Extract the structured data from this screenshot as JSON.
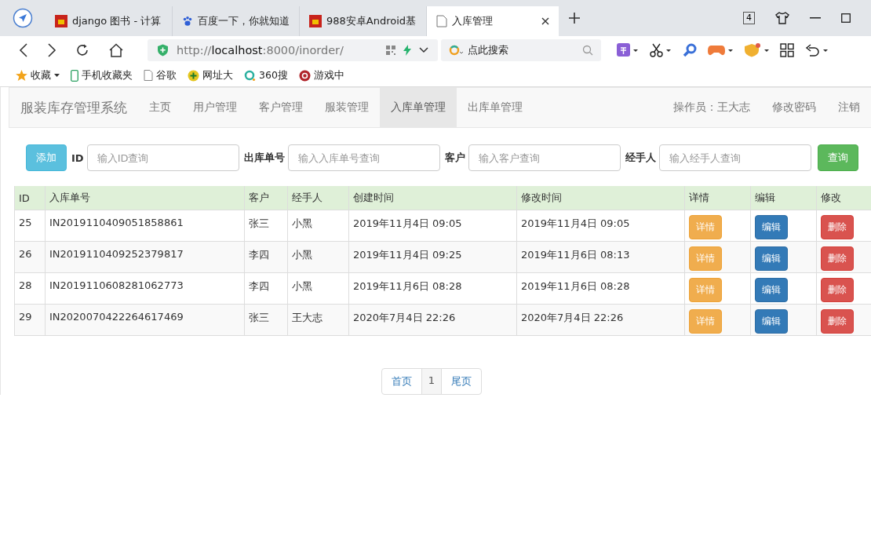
{
  "browser": {
    "tabs": [
      {
        "title": "django 图书 - 计算",
        "kind": "flag",
        "selected": false
      },
      {
        "title": "百度一下，你就知道",
        "kind": "paw",
        "selected": false
      },
      {
        "title": "988安卓Android基",
        "kind": "flag",
        "selected": false
      },
      {
        "title": "入库管理",
        "kind": "doc",
        "selected": true
      }
    ],
    "tab_count": "4",
    "url": {
      "scheme": "http://",
      "host": "localhost",
      "path": ":8000/inorder/"
    },
    "search": {
      "placeholder": "点此搜索"
    },
    "bookmarks": [
      {
        "label": "收藏",
        "kind": "star"
      },
      {
        "label": "手机收藏夹",
        "kind": "phone"
      },
      {
        "label": "谷歌",
        "kind": "doc"
      },
      {
        "label": "网址大",
        "kind": "plus"
      },
      {
        "label": "360搜",
        "kind": "ring"
      },
      {
        "label": "游戏中",
        "kind": "game"
      }
    ]
  },
  "navbar": {
    "brand": "服装库存管理系统",
    "items": [
      {
        "label": "主页",
        "selected": false
      },
      {
        "label": "用户管理",
        "selected": false
      },
      {
        "label": "客户管理",
        "selected": false
      },
      {
        "label": "服装管理",
        "selected": false
      },
      {
        "label": "入库单管理",
        "selected": true
      },
      {
        "label": "出库单管理",
        "selected": false
      }
    ],
    "operator": "操作员：王大志",
    "links": [
      "修改密码",
      "注销"
    ]
  },
  "filters": {
    "add_button": "添加",
    "fields": [
      {
        "label": "ID",
        "placeholder": "输入ID查询"
      },
      {
        "label": "出库单号",
        "placeholder": "输入入库单号查询"
      },
      {
        "label": "客户",
        "placeholder": "输入客户查询"
      },
      {
        "label": "经手人",
        "placeholder": "输入经手人查询"
      }
    ],
    "search_button": "查询"
  },
  "table": {
    "columns": [
      "ID",
      "入库单号",
      "客户",
      "经手人",
      "创建时间",
      "修改时间",
      "详情",
      "编辑",
      "修改"
    ],
    "rows": [
      {
        "cells": [
          "25",
          "IN2019110409051858861",
          "张三",
          "小黑",
          "2019年11月4日 09:05",
          "2019年11月4日 09:05"
        ],
        "actions": [
          "详情",
          "编辑",
          "删除"
        ]
      },
      {
        "cells": [
          "26",
          "IN2019110409252379817",
          "李四",
          "小黑",
          "2019年11月4日 09:25",
          "2019年11月6日 08:13"
        ],
        "actions": [
          "详情",
          "编辑",
          "删除"
        ]
      },
      {
        "cells": [
          "28",
          "IN2019110608281062773",
          "李四",
          "小黑",
          "2019年11月6日 08:28",
          "2019年11月6日 08:28"
        ],
        "actions": [
          "详情",
          "编辑",
          "删除"
        ]
      },
      {
        "cells": [
          "29",
          "IN2020070422264617469",
          "张三",
          "王大志",
          "2020年7月4日 22:26",
          "2020年7月4日 22:26"
        ],
        "actions": [
          "详情",
          "编辑",
          "删除"
        ]
      }
    ]
  },
  "pagination": [
    {
      "label": "首页",
      "selected": false
    },
    {
      "label": "1",
      "selected": true
    },
    {
      "label": "尾页",
      "selected": false
    }
  ]
}
